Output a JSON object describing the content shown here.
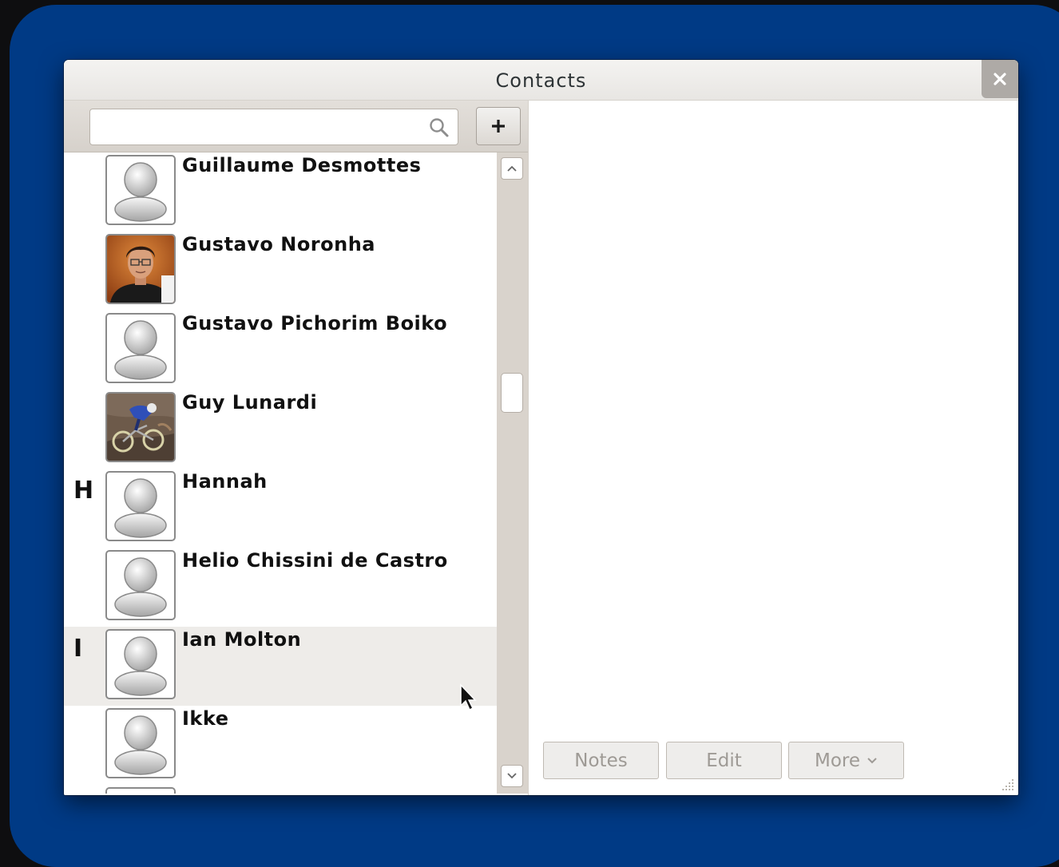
{
  "window": {
    "title": "Contacts"
  },
  "search": {
    "value": "",
    "placeholder": ""
  },
  "toolbar": {
    "add_label": "+"
  },
  "contacts": [
    {
      "letter": "",
      "name": "Guillaume Desmottes",
      "avatar": "default-person-icon"
    },
    {
      "letter": "",
      "name": "Gustavo Noronha",
      "avatar": "photo-portrait"
    },
    {
      "letter": "",
      "name": "Gustavo Pichorim Boiko",
      "avatar": "default-person-icon"
    },
    {
      "letter": "",
      "name": "Guy Lunardi",
      "avatar": "photo-mountain-bike"
    },
    {
      "letter": "H",
      "name": "Hannah",
      "avatar": "default-person-icon"
    },
    {
      "letter": "",
      "name": "Helio Chissini de Castro",
      "avatar": "default-person-icon"
    },
    {
      "letter": "I",
      "name": "Ian Molton",
      "avatar": "default-person-icon",
      "selected": true
    },
    {
      "letter": "",
      "name": "Ikke",
      "avatar": "default-person-icon"
    }
  ],
  "actions": {
    "notes": "Notes",
    "edit": "Edit",
    "more": "More"
  },
  "scrollbar": {
    "position": 0.35
  },
  "colors": {
    "desktop": "#003a85",
    "selected_row": "#eeece9",
    "scroll_trough": "#d9d3cc"
  }
}
